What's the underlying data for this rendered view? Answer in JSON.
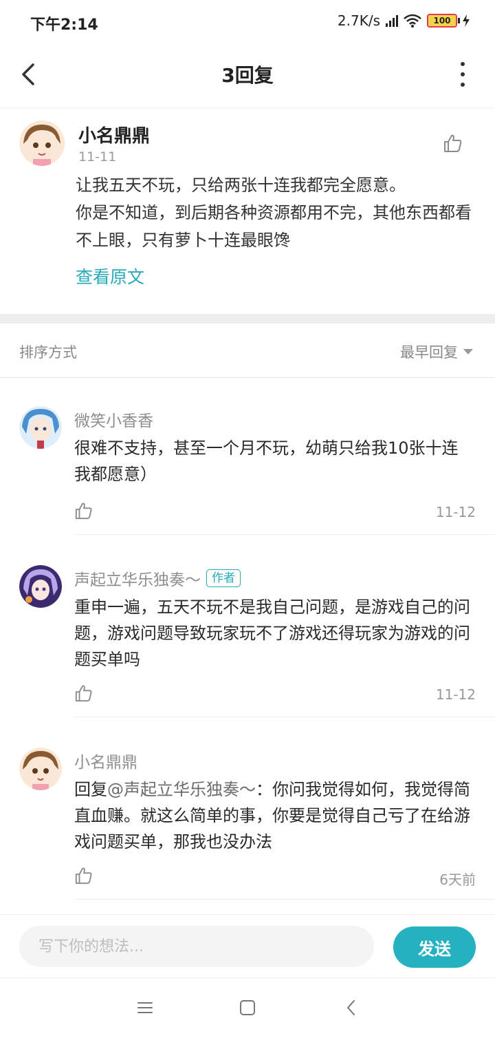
{
  "status_bar": {
    "time": "下午2:14",
    "net_speed": "2.7K/s",
    "battery": "100",
    "battery_level": 1.0
  },
  "header": {
    "title": "3回复"
  },
  "original_comment": {
    "username": "小名鼎鼎",
    "date": "11-11",
    "text_line1": "让我五天不玩，只给两张十连我都完全愿意。",
    "text_line2": "你是不知道，到后期各种资源都用不完，其他东西都看不上眼，只有萝卜十连最眼馋",
    "view_original": "查看原文"
  },
  "sort": {
    "label": "排序方式",
    "selected": "最早回复"
  },
  "replies": [
    {
      "username": "微笑小香香",
      "text": "很难不支持，甚至一个月不玩，幼萌只给我10张十连我都愿意）",
      "time": "11-12"
    },
    {
      "username": "声起立华乐独奏～",
      "badge": "作者",
      "text": "重申一遍，五天不玩不是我自己问题，是游戏自己的问题，游戏问题导致玩家玩不了游戏还得玩家为游戏的问题买单吗",
      "time": "11-12"
    },
    {
      "username": "小名鼎鼎",
      "reply_prefix": "回复",
      "mention": "@声起立华乐独奏～",
      "text": "：你问我觉得如何，我觉得简直血赚。就这么简单的事，你要是觉得自己亏了在给游戏问题买单，那我也没办法",
      "time": "6天前"
    }
  ],
  "input_bar": {
    "placeholder": "写下你的想法...",
    "send_label": "发送"
  },
  "colors": {
    "accent": "#25b1bf",
    "link": "#25aab8",
    "divider": "#ededed"
  }
}
